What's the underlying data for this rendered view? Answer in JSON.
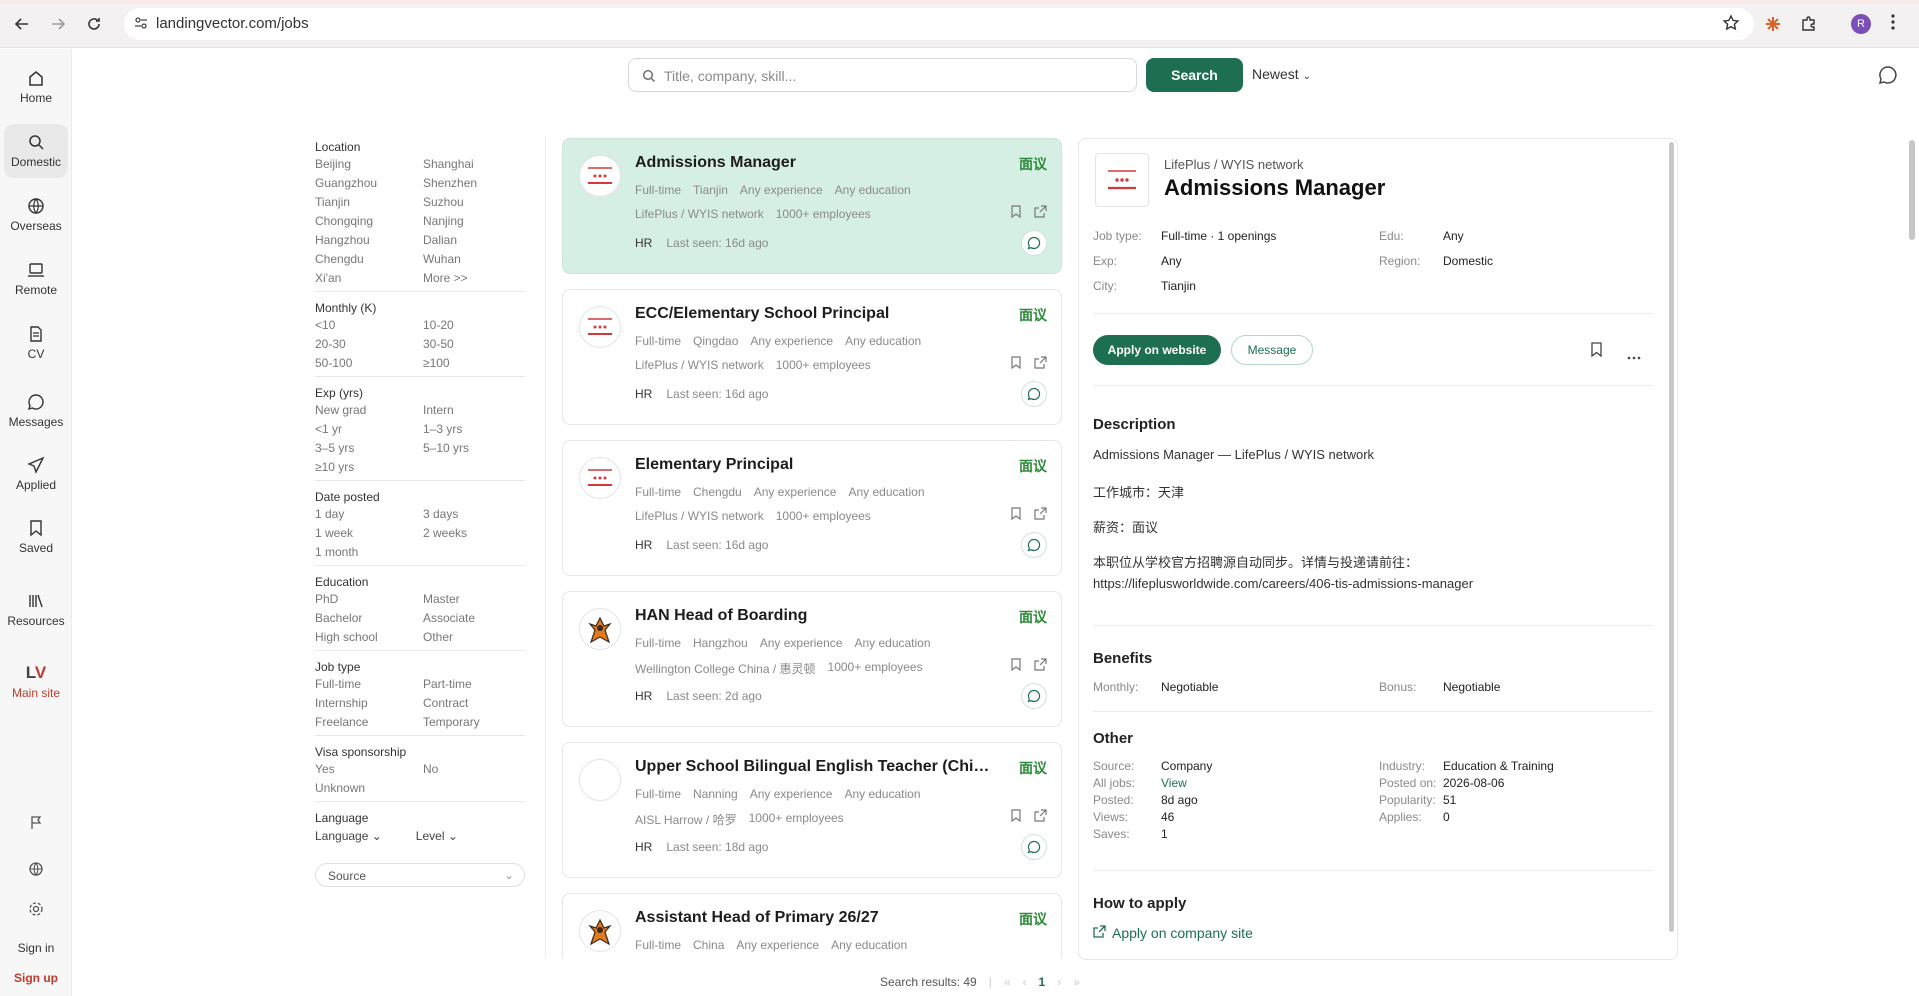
{
  "browser": {
    "url": "landingvector.com/jobs",
    "profile_initial": "R"
  },
  "sidebar": {
    "items": [
      {
        "label": "Home"
      },
      {
        "label": "Domestic"
      },
      {
        "label": "Overseas"
      },
      {
        "label": "Remote"
      },
      {
        "label": "CV"
      },
      {
        "label": "Messages"
      },
      {
        "label": "Applied"
      },
      {
        "label": "Saved"
      },
      {
        "label": "Resources"
      },
      {
        "label": "Main site"
      }
    ],
    "logo_text_l": "L",
    "logo_text_v": "V",
    "sign_in": "Sign in",
    "sign_up": "Sign up"
  },
  "search": {
    "placeholder": "Title, company, skill...",
    "button": "Search",
    "sort": "Newest"
  },
  "filters": {
    "location": {
      "title": "Location",
      "options": [
        "Beijing",
        "Shanghai",
        "Guangzhou",
        "Shenzhen",
        "Tianjin",
        "Suzhou",
        "Chongqing",
        "Nanjing",
        "Hangzhou",
        "Dalian",
        "Chengdu",
        "Wuhan",
        "Xi'an",
        "More >>"
      ]
    },
    "monthly": {
      "title": "Monthly (K)",
      "options": [
        "<10",
        "10-20",
        "20-30",
        "30-50",
        "50-100",
        "≥100"
      ]
    },
    "exp": {
      "title": "Exp (yrs)",
      "options": [
        "New grad",
        "Intern",
        "<1 yr",
        "1–3 yrs",
        "3–5 yrs",
        "5–10 yrs",
        "≥10 yrs"
      ]
    },
    "date": {
      "title": "Date posted",
      "options": [
        "1 day",
        "3 days",
        "1 week",
        "2 weeks",
        "1 month"
      ]
    },
    "education": {
      "title": "Education",
      "options": [
        "PhD",
        "Master",
        "Bachelor",
        "Associate",
        "High school",
        "Other"
      ]
    },
    "jobtype": {
      "title": "Job type",
      "options": [
        "Full-time",
        "Part-time",
        "Internship",
        "Contract",
        "Freelance",
        "Temporary"
      ]
    },
    "visa": {
      "title": "Visa sponsorship",
      "options": [
        "Yes",
        "No",
        "Unknown"
      ]
    },
    "language": {
      "title": "Language",
      "language_dd": "Language",
      "level_dd": "Level"
    },
    "source": "Source"
  },
  "jobs": [
    {
      "title": "Admissions Manager",
      "salary": "面议",
      "type": "Full-time",
      "city": "Tianjin",
      "exp": "Any experience",
      "edu": "Any education",
      "company": "LifePlus / WYIS network",
      "size": "1000+ employees",
      "hr": "HR",
      "seen": "Last seen: 16d ago"
    },
    {
      "title": "ECC/Elementary School Principal",
      "salary": "面议",
      "type": "Full-time",
      "city": "Qingdao",
      "exp": "Any experience",
      "edu": "Any education",
      "company": "LifePlus / WYIS network",
      "size": "1000+ employees",
      "hr": "HR",
      "seen": "Last seen: 16d ago"
    },
    {
      "title": "Elementary Principal",
      "salary": "面议",
      "type": "Full-time",
      "city": "Chengdu",
      "exp": "Any experience",
      "edu": "Any education",
      "company": "LifePlus / WYIS network",
      "size": "1000+ employees",
      "hr": "HR",
      "seen": "Last seen: 16d ago"
    },
    {
      "title": "HAN Head of Boarding",
      "salary": "面议",
      "type": "Full-time",
      "city": "Hangzhou",
      "exp": "Any experience",
      "edu": "Any education",
      "company": "Wellington College China / 惠灵顿",
      "size": "1000+ employees",
      "hr": "HR",
      "seen": "Last seen: 2d ago"
    },
    {
      "title": "Upper School Bilingual English Teacher (Chinese)",
      "salary": "面议",
      "type": "Full-time",
      "city": "Nanning",
      "exp": "Any experience",
      "edu": "Any education",
      "company": "AISL Harrow / 哈罗",
      "size": "1000+ employees",
      "hr": "HR",
      "seen": "Last seen: 18d ago"
    },
    {
      "title": "Assistant Head of Primary 26/27",
      "salary": "面议",
      "type": "Full-time",
      "city": "China",
      "exp": "Any experience",
      "edu": "Any education"
    }
  ],
  "pager": {
    "results": "Search results: 49",
    "separator": "|",
    "first": "«",
    "prev": "‹",
    "page": "1",
    "next": "›",
    "last": "»"
  },
  "detail": {
    "org": "LifePlus / WYIS network",
    "title": "Admissions Manager",
    "job_type_k": "Job type:",
    "job_type_v": "Full-time · 1 openings",
    "edu_k": "Edu:",
    "edu_v": "Any",
    "exp_k": "Exp:",
    "exp_v": "Any",
    "region_k": "Region:",
    "region_v": "Domestic",
    "city_k": "City:",
    "city_v": "Tianjin",
    "apply_btn": "Apply on website",
    "message_btn": "Message",
    "desc_h": "Description",
    "desc1": "Admissions Manager — LifePlus / WYIS network",
    "desc2": "工作城市：天津",
    "desc3": "薪资：面议",
    "desc4": "本职位从学校官方招聘源自动同步。详情与投递请前往：",
    "desc5": "https://lifeplusworldwide.com/careers/406-tis-admissions-manager",
    "benefits_h": "Benefits",
    "monthly_k": "Monthly:",
    "monthly_v": "Negotiable",
    "bonus_k": "Bonus:",
    "bonus_v": "Negotiable",
    "other_h": "Other",
    "source_k": "Source:",
    "source_v": "Company",
    "alljobs_k": "All jobs:",
    "alljobs_v": "View",
    "posted_k": "Posted:",
    "posted_v": "8d ago",
    "views_k": "Views:",
    "views_v": "46",
    "saves_k": "Saves:",
    "saves_v": "1",
    "industry_k": "Industry:",
    "industry_v": "Education & Training",
    "postedon_k": "Posted on:",
    "postedon_v": "2026-08-06",
    "popularity_k": "Popularity:",
    "popularity_v": "51",
    "applies_k": "Applies:",
    "applies_v": "0",
    "howto_h": "How to apply",
    "apply_link": "Apply on company site"
  }
}
